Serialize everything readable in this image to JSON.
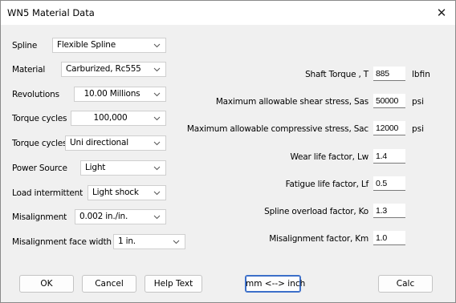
{
  "window": {
    "title": "WN5 Material Data",
    "close_label": "✕"
  },
  "left_fields": [
    {
      "label": "Spline",
      "value": "Flexible Spline",
      "centered": false
    },
    {
      "label": "Material",
      "value": "Carburized, Rc555",
      "centered": false
    },
    {
      "label": "Revolutions",
      "value": "10.00 Millions",
      "centered": true
    },
    {
      "label": "Torque cycles",
      "value": "100,000",
      "centered": true
    },
    {
      "label": "Torque cycles",
      "value": "Uni directional",
      "centered": false
    },
    {
      "label": "Power Source",
      "value": "Light",
      "centered": false
    },
    {
      "label": "Load intermittent",
      "value": "Light shock",
      "centered": false
    },
    {
      "label": "Misalignment",
      "value": "0.002 in./in.",
      "centered": false
    },
    {
      "label": "Misalignment face width",
      "value": "1 in.",
      "centered": false
    }
  ],
  "right_fields": [
    {
      "label": "Shaft Torque , T",
      "value": "885",
      "unit": "lbfin"
    },
    {
      "label": "Maximum allowable shear stress, Sas",
      "value": "50000",
      "unit": "psi"
    },
    {
      "label": "Maximum allowable compressive stress, Sac",
      "value": "12000",
      "unit": "psi"
    },
    {
      "label": "Wear life factor, Lw",
      "value": "1.4",
      "unit": ""
    },
    {
      "label": "Fatigue life factor, Lf",
      "value": "0.5",
      "unit": ""
    },
    {
      "label": "Spline overload factor, Ko",
      "value": "1.3",
      "unit": ""
    },
    {
      "label": "Misalignment factor, Km",
      "value": "1.0",
      "unit": ""
    }
  ],
  "buttons": {
    "ok": "OK",
    "cancel": "Cancel",
    "help": "Help Text",
    "units": "mm <--> inch",
    "calc": "Calc"
  }
}
